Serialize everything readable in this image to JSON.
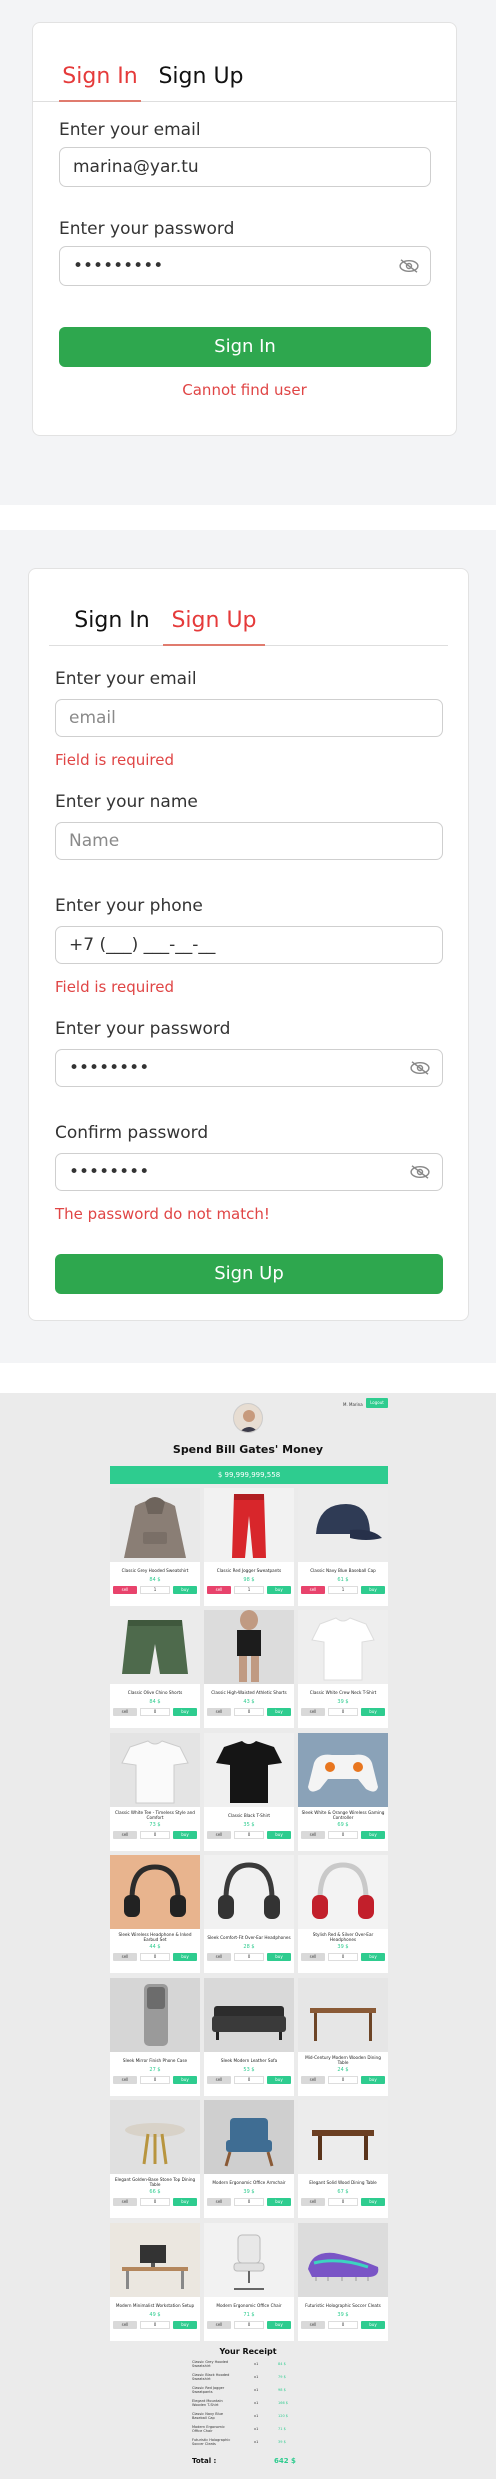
{
  "signin": {
    "tab_signin": "Sign In",
    "tab_signup": "Sign Up",
    "email_label": "Enter your email",
    "email_value": "marina@yar.tu",
    "password_label": "Enter your password",
    "password_value": "•••••••••",
    "submit": "Sign In",
    "error": "Cannot find user"
  },
  "signup": {
    "tab_signin": "Sign In",
    "tab_signup": "Sign Up",
    "email_label": "Enter your email",
    "email_placeholder": "email",
    "email_error": "Field is required",
    "name_label": "Enter your name",
    "name_placeholder": "Name",
    "phone_label": "Enter your phone",
    "phone_value": "+7 (___) ___-__-__",
    "phone_error": "Field is required",
    "password_label": "Enter your password",
    "password_value": "••••••••",
    "confirm_label": "Confirm password",
    "confirm_value": "••••••••",
    "confirm_error": "The password do not match!",
    "submit": "Sign Up"
  },
  "shop": {
    "user": "M. Marina",
    "login": "Logout",
    "title": "Spend Bill Gates' Money",
    "money": "$ 99,999,999,558",
    "sell_label": "sell",
    "buy_label": "buy",
    "products": [
      {
        "name": "Classic Grey Hooded Sweatshirt",
        "price": "84 $",
        "qty": "1",
        "art": "hoodie",
        "can_sell": true
      },
      {
        "name": "Classic Red Jogger Sweatpants",
        "price": "98 $",
        "qty": "1",
        "art": "pants",
        "can_sell": true
      },
      {
        "name": "Classic Navy Blue Baseball Cap",
        "price": "61 $",
        "qty": "1",
        "art": "cap",
        "can_sell": true
      },
      {
        "name": "Classic Olive Chino Shorts",
        "price": "84 $",
        "qty": "0",
        "art": "shorts",
        "can_sell": false
      },
      {
        "name": "Classic High-Waisted Athletic Shorts",
        "price": "43 $",
        "qty": "0",
        "art": "athletic",
        "can_sell": false
      },
      {
        "name": "Classic White Crew Neck T-Shirt",
        "price": "39 $",
        "qty": "0",
        "art": "tshirt",
        "can_sell": false
      },
      {
        "name": "Classic White Tee - Timeless Style and Comfort",
        "price": "73 $",
        "qty": "0",
        "art": "whitetee",
        "can_sell": false
      },
      {
        "name": "Classic Black T-Shirt",
        "price": "35 $",
        "qty": "0",
        "art": "blacktee",
        "can_sell": false
      },
      {
        "name": "Sleek White & Orange Wireless Gaming Controller",
        "price": "69 $",
        "qty": "0",
        "art": "controller",
        "can_sell": false
      },
      {
        "name": "Sleek Wireless Headphone & Inked Earbud Set",
        "price": "44 $",
        "qty": "0",
        "art": "headphones1",
        "can_sell": false
      },
      {
        "name": "Sleek Comfort-Fit Over-Ear Headphones",
        "price": "28 $",
        "qty": "0",
        "art": "headphones2",
        "can_sell": false
      },
      {
        "name": "Stylish Red & Silver Over-Ear Headphones",
        "price": "39 $",
        "qty": "0",
        "art": "headphones3",
        "can_sell": false
      },
      {
        "name": "Sleek Mirror Finish Phone Case",
        "price": "27 $",
        "qty": "0",
        "art": "phonecase",
        "can_sell": false
      },
      {
        "name": "Sleek Modern Leather Sofa",
        "price": "53 $",
        "qty": "0",
        "art": "sofa",
        "can_sell": false
      },
      {
        "name": "Mid-Century Modern Wooden Dining Table",
        "price": "24 $",
        "qty": "0",
        "art": "table1",
        "can_sell": false
      },
      {
        "name": "Elegant Golden-Base Stone Top Dining Table",
        "price": "66 $",
        "qty": "0",
        "art": "table2",
        "can_sell": false
      },
      {
        "name": "Modern Ergonomic Office Armchair",
        "price": "39 $",
        "qty": "0",
        "art": "armchair",
        "can_sell": false
      },
      {
        "name": "Elegant Solid Wood Dining Table",
        "price": "67 $",
        "qty": "0",
        "art": "table3",
        "can_sell": false
      },
      {
        "name": "Modern Minimalist Workstation Setup",
        "price": "49 $",
        "qty": "0",
        "art": "workstation",
        "can_sell": false
      },
      {
        "name": "Modern Ergonomic Office Chair",
        "price": "71 $",
        "qty": "0",
        "art": "officechair",
        "can_sell": false
      },
      {
        "name": "Futuristic Holographic Soccer Cleats",
        "price": "39 $",
        "qty": "0",
        "art": "cleats",
        "can_sell": false
      }
    ],
    "receipt_title": "Your Receipt",
    "receipt": [
      {
        "name": "Classic Grey Hooded Sweatshirt",
        "qty": "x1",
        "price": "84 $"
      },
      {
        "name": "Classic Black Hooded Sweatshirt",
        "qty": "x1",
        "price": "79 $"
      },
      {
        "name": "Classic Red Jogger Sweatpants",
        "qty": "x1",
        "price": "98 $"
      },
      {
        "name": "Elegant Mountain Wooden T-Shirt",
        "qty": "x1",
        "price": "166 $"
      },
      {
        "name": "Classic Navy Blue Baseball Cap",
        "qty": "x1",
        "price": "120 $"
      },
      {
        "name": "Modern Ergonomic Office Chair",
        "qty": "x1",
        "price": "71 $"
      },
      {
        "name": "Futuristic Holographic Soccer Cleats",
        "qty": "x1",
        "price": "39 $"
      }
    ],
    "total_label": "Total :",
    "total_value": "642 $"
  }
}
